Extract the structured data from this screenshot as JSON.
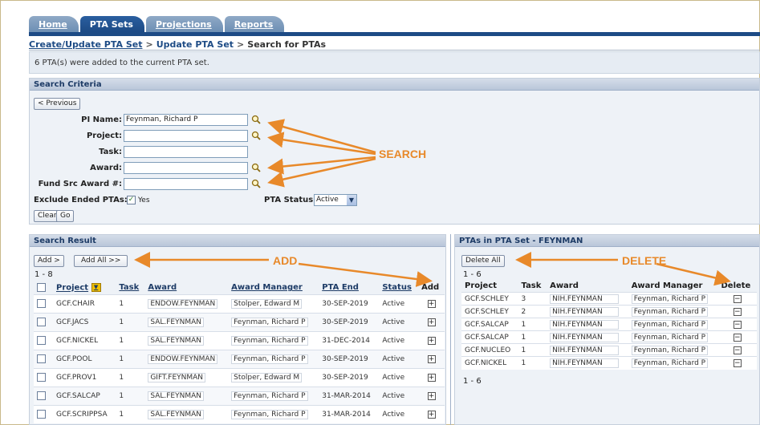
{
  "tabs": [
    {
      "label": "Home",
      "active": false
    },
    {
      "label": "PTA Sets",
      "active": true
    },
    {
      "label": "Projections",
      "active": false
    },
    {
      "label": "Reports",
      "active": false
    }
  ],
  "breadcrumb": {
    "first": "Create/Update PTA Set",
    "second": "Update PTA Set",
    "current": "Search for PTAs",
    "sep": ">"
  },
  "message": "6 PTA(s) were added to the current PTA set.",
  "criteria": {
    "title": "Search Criteria",
    "previous_label": "< Previous",
    "pi_name_label": "PI Name:",
    "pi_name_value": "Feynman, Richard P",
    "project_label": "Project:",
    "project_value": "",
    "task_label": "Task:",
    "task_value": "",
    "award_label": "Award:",
    "award_value": "",
    "fund_label": "Fund Src Award #:",
    "fund_value": "",
    "exclude_label": "Exclude Ended PTAs:",
    "exclude_checked": "✓",
    "exclude_yes": "Yes",
    "status_label": "PTA Status:",
    "status_value": "Active",
    "clear_label": "Clear",
    "go_label": "Go"
  },
  "annotations": {
    "search": "SEARCH",
    "add": "ADD",
    "delete": "DELETE"
  },
  "search_result": {
    "title": "Search Result",
    "add_label": "Add >",
    "add_all_label": "Add All >>",
    "range": "1 - 8",
    "columns": {
      "project": "Project",
      "task": "Task",
      "award": "Award",
      "manager": "Award Manager",
      "end": "PTA End",
      "status": "Status",
      "add": "Add"
    },
    "rows": [
      {
        "project": "GCF.CHAIR",
        "task": "1",
        "award": "ENDOW.FEYNMAN",
        "manager": "Stolper, Edward M",
        "end": "30-SEP-2019",
        "status": "Active"
      },
      {
        "project": "GCF.JACS",
        "task": "1",
        "award": "SAL.FEYNMAN",
        "manager": "Feynman, Richard P",
        "end": "30-SEP-2019",
        "status": "Active"
      },
      {
        "project": "GCF.NICKEL",
        "task": "1",
        "award": "SAL.FEYNMAN",
        "manager": "Feynman, Richard P",
        "end": "31-DEC-2014",
        "status": "Active"
      },
      {
        "project": "GCF.POOL",
        "task": "1",
        "award": "ENDOW.FEYNMAN",
        "manager": "Feynman, Richard P",
        "end": "30-SEP-2019",
        "status": "Active"
      },
      {
        "project": "GCF.PROV1",
        "task": "1",
        "award": "GIFT.FEYNMAN",
        "manager": "Stolper, Edward M",
        "end": "30-SEP-2019",
        "status": "Active"
      },
      {
        "project": "GCF.SALCAP",
        "task": "1",
        "award": "SAL.FEYNMAN",
        "manager": "Feynman, Richard P",
        "end": "31-MAR-2014",
        "status": "Active"
      },
      {
        "project": "GCF.SCRIPPSA",
        "task": "1",
        "award": "SAL.FEYNMAN",
        "manager": "Feynman, Richard P",
        "end": "31-MAR-2014",
        "status": "Active"
      }
    ]
  },
  "pta_set": {
    "title": "PTAs in PTA Set - FEYNMAN",
    "delete_all_label": "Delete All",
    "range_top": "1 - 6",
    "range_bottom": "1 - 6",
    "columns": {
      "project": "Project",
      "task": "Task",
      "award": "Award",
      "manager": "Award Manager",
      "delete": "Delete"
    },
    "rows": [
      {
        "project": "GCF.SCHLEY",
        "task": "3",
        "award": "NIH.FEYNMAN",
        "manager": "Feynman, Richard P"
      },
      {
        "project": "GCF.SCHLEY",
        "task": "2",
        "award": "NIH.FEYNMAN",
        "manager": "Feynman, Richard P"
      },
      {
        "project": "GCF.SALCAP",
        "task": "1",
        "award": "NIH.FEYNMAN",
        "manager": "Feynman, Richard P"
      },
      {
        "project": "GCF.SALCAP",
        "task": "1",
        "award": "NIH.FEYNMAN",
        "manager": "Feynman, Richard P"
      },
      {
        "project": "GCF.NUCLEO",
        "task": "1",
        "award": "NIH.FEYNMAN",
        "manager": "Feynman, Richard P"
      },
      {
        "project": "GCF.NICKEL",
        "task": "1",
        "award": "NIH.FEYNMAN",
        "manager": "Feynman, Richard P"
      }
    ]
  },
  "colors": {
    "annotation": "#e8892a",
    "tab_active": "#1d4b85",
    "tab_inactive": "#7f9dbf",
    "panel_header": "#c7d2e2"
  },
  "icons": {
    "search": "magnifier-icon",
    "add": "plus-box-icon",
    "delete": "minus-box-icon",
    "sort": "sort-dropdown-icon"
  }
}
